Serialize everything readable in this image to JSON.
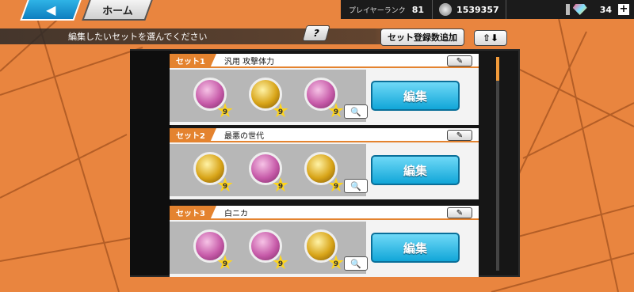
{
  "header": {
    "back_icon": "left-arrow-icon",
    "home_label": "ホーム",
    "rank_label": "プレイヤーランク",
    "rank_value": "81",
    "coin_value": "1539357",
    "gem_value": "34",
    "plus_label": "+"
  },
  "toolbar": {
    "instruction": "編集したいセットを選んでください",
    "help_label": "?",
    "add_sets_label": "セット登録数追加",
    "sort_label": "⇧⬇"
  },
  "sets": [
    {
      "tag": "セット1",
      "name": "汎用 攻撃体力",
      "medals": [
        "pink",
        "gold",
        "pink"
      ],
      "levels": [
        "9",
        "9",
        "9"
      ],
      "edit_label": "編集"
    },
    {
      "tag": "セット2",
      "name": "最悪の世代",
      "medals": [
        "gold",
        "pink",
        "gold"
      ],
      "levels": [
        "9",
        "9",
        "9"
      ],
      "edit_label": "編集"
    },
    {
      "tag": "セット3",
      "name": "白ニカ",
      "medals": [
        "pink",
        "pink",
        "gold"
      ],
      "levels": [
        "9",
        "9",
        "9"
      ],
      "edit_label": "編集"
    }
  ],
  "colors": {
    "background": "#e9853f",
    "accent": "#e4832f",
    "edit_button": "#11a6d8"
  }
}
